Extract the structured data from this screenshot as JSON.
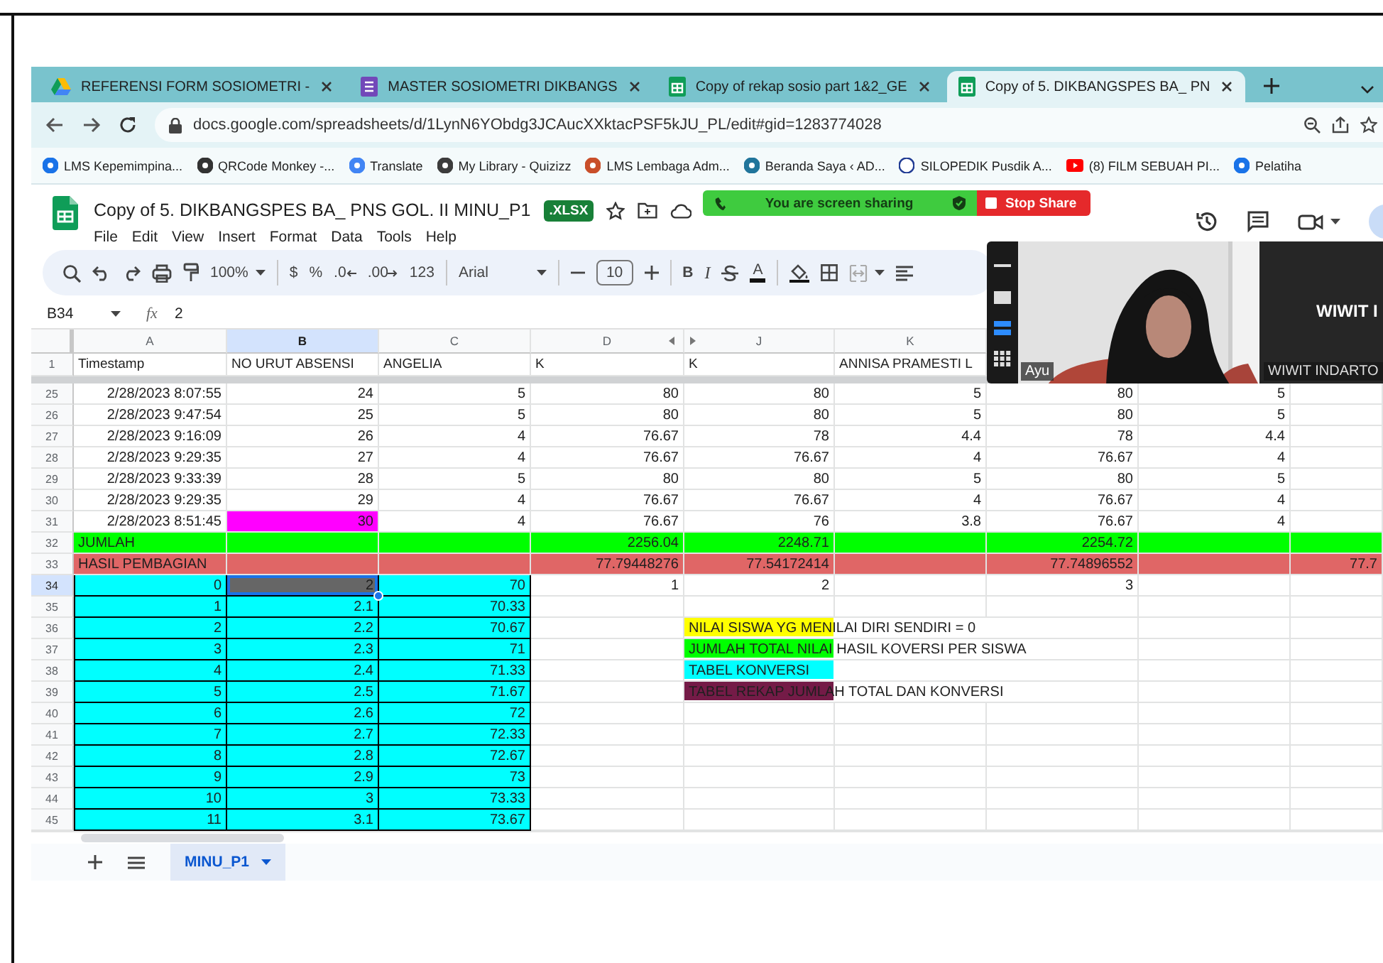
{
  "browser": {
    "tabs": [
      {
        "kind": "drive",
        "title": "REFERENSI FORM SOSIOMETRI -",
        "selected": false
      },
      {
        "kind": "form",
        "title": "MASTER SOSIOMETRI DIKBANGS",
        "selected": false
      },
      {
        "kind": "sheet",
        "title": "Copy of rekap sosio part 1&2_GE",
        "selected": false
      },
      {
        "kind": "sheet",
        "title": "Copy of 5. DIKBANGSPES BA_ PN",
        "selected": true
      }
    ],
    "url": "docs.google.com/spreadsheets/d/1LynN6YObdg3JCAucXXktacPSF5kJU_PL/edit#gid=1283774028",
    "bookmarks": [
      "LMS Kepemimpina...",
      "QRCode Monkey -...",
      "Translate",
      "My Library - Quizizz",
      "LMS Lembaga Adm...",
      "Beranda Saya ‹ AD...",
      "SILOPEDIK Pusdik A...",
      "(8) FILM SEBUAH PI...",
      "Pelatiha"
    ]
  },
  "sheets": {
    "title": "Copy of 5. DIKBANGSPES BA_ PNS GOL. II MINU_P1",
    "badge": ".XLSX",
    "menu": [
      "File",
      "Edit",
      "View",
      "Insert",
      "Format",
      "Data",
      "Tools",
      "Help"
    ],
    "toolbar": {
      "zoom": "100%",
      "currency": "$",
      "percent": "%",
      "decrease_decimals": ".0",
      "increase_decimals": ".00",
      "number_format": "123",
      "font": "Arial",
      "font_size": "10",
      "bold": "B",
      "italic": "I",
      "text_color": "A"
    },
    "formula": {
      "cell": "B34",
      "label": "fx",
      "value": "2"
    }
  },
  "grid": {
    "columns": [
      {
        "letter": "A",
        "selected": false
      },
      {
        "letter": "B",
        "selected": true
      },
      {
        "letter": "C",
        "selected": false
      },
      {
        "letter": "D",
        "selected": false
      },
      {
        "letter": "J",
        "selected": false
      },
      {
        "letter": "K",
        "selected": false
      }
    ],
    "rows": [
      {
        "number": "1",
        "kind": "header",
        "cells": [
          "Timestamp",
          "NO URUT ABSENSI",
          "ANGELIA",
          "K",
          "K",
          "ANNISA PRAMESTI L"
        ]
      },
      {
        "number": "25",
        "kind": "data",
        "cells": [
          "2/28/2023 8:07:55",
          "24",
          "5",
          "80",
          "80",
          "5",
          "80",
          "5"
        ]
      },
      {
        "number": "26",
        "kind": "data",
        "cells": [
          "2/28/2023 9:47:54",
          "25",
          "5",
          "80",
          "80",
          "5",
          "80",
          "5"
        ]
      },
      {
        "number": "27",
        "kind": "data",
        "cells": [
          "2/28/2023 9:16:09",
          "26",
          "4",
          "76.67",
          "78",
          "4.4",
          "78",
          "4.4"
        ]
      },
      {
        "number": "28",
        "kind": "data",
        "cells": [
          "2/28/2023 9:29:35",
          "27",
          "4",
          "76.67",
          "76.67",
          "4",
          "76.67",
          "4"
        ]
      },
      {
        "number": "29",
        "kind": "data",
        "cells": [
          "2/28/2023 9:33:39",
          "28",
          "5",
          "80",
          "80",
          "5",
          "80",
          "5"
        ]
      },
      {
        "number": "30",
        "kind": "data",
        "cells": [
          "2/28/2023 9:29:35",
          "29",
          "4",
          "76.67",
          "76.67",
          "4",
          "76.67",
          "4"
        ]
      },
      {
        "number": "31",
        "kind": "data",
        "cells": [
          "2/28/2023 8:51:45",
          {
            "text": "30",
            "color": "#ff00ff"
          },
          "4",
          "76.67",
          "76",
          "3.8",
          "76.67",
          "4"
        ]
      },
      {
        "number": "32",
        "kind": "summary",
        "color": "#00ff00",
        "cells": [
          {
            "text": "JUMLAH",
            "kind": "label"
          },
          null,
          null,
          "2256.04",
          "2248.71",
          null,
          "2254.72"
        ]
      },
      {
        "number": "33",
        "kind": "summary",
        "color": "#e06666",
        "cells": [
          {
            "text": "HASIL PEMBAGIAN",
            "kind": "label"
          },
          null,
          null,
          "77.79448276",
          "77.54172414",
          null,
          "77.74896552",
          null,
          "77.7"
        ]
      },
      {
        "number": "34",
        "kind": "conversion",
        "cells": [
          {
            "text": "0",
            "color": "#00ffff"
          },
          {
            "text": "2",
            "color": "#666666",
            "selected": true
          },
          {
            "text": "70",
            "color": "#00ffff"
          },
          "1",
          "2",
          null,
          "3"
        ]
      },
      {
        "number": "35",
        "kind": "conversion",
        "cells": [
          {
            "text": "1",
            "color": "#00ffff"
          },
          {
            "text": "2.1",
            "color": "#00ffff"
          },
          {
            "text": "70.33",
            "color": "#00ffff"
          }
        ]
      },
      {
        "number": "36",
        "kind": "conversion",
        "cells": [
          {
            "text": "2",
            "color": "#00ffff"
          },
          {
            "text": "2.2",
            "color": "#00ffff"
          },
          {
            "text": "70.67",
            "color": "#00ffff"
          },
          null,
          {
            "text": "NILAI SISWA YG MENILAI DIRI SENDIRI = 0",
            "color": "#ffff00",
            "kind": "label"
          }
        ]
      },
      {
        "number": "37",
        "kind": "conversion",
        "cells": [
          {
            "text": "3",
            "color": "#00ffff"
          },
          {
            "text": "2.3",
            "color": "#00ffff"
          },
          {
            "text": "71",
            "color": "#00ffff"
          },
          null,
          {
            "text": "JUMLAH TOTAL NILAI HASIL KOVERSI PER SISWA",
            "color": "#00ff00",
            "kind": "label"
          }
        ]
      },
      {
        "number": "38",
        "kind": "conversion",
        "cells": [
          {
            "text": "4",
            "color": "#00ffff"
          },
          {
            "text": "2.4",
            "color": "#00ffff"
          },
          {
            "text": "71.33",
            "color": "#00ffff"
          },
          null,
          {
            "text": "TABEL KONVERSI",
            "color": "#00ffff",
            "kind": "label"
          }
        ]
      },
      {
        "number": "39",
        "kind": "conversion",
        "cells": [
          {
            "text": "5",
            "color": "#00ffff"
          },
          {
            "text": "2.5",
            "color": "#00ffff"
          },
          {
            "text": "71.67",
            "color": "#00ffff"
          },
          null,
          {
            "text": "TABEL REKAP JUMLAH TOTAL DAN KONVERSI",
            "color": "#741b47",
            "kind": "label"
          }
        ]
      },
      {
        "number": "40",
        "kind": "conversion",
        "cells": [
          {
            "text": "6",
            "color": "#00ffff"
          },
          {
            "text": "2.6",
            "color": "#00ffff"
          },
          {
            "text": "72",
            "color": "#00ffff"
          }
        ]
      },
      {
        "number": "41",
        "kind": "conversion",
        "cells": [
          {
            "text": "7",
            "color": "#00ffff"
          },
          {
            "text": "2.7",
            "color": "#00ffff"
          },
          {
            "text": "72.33",
            "color": "#00ffff"
          }
        ]
      },
      {
        "number": "42",
        "kind": "conversion",
        "cells": [
          {
            "text": "8",
            "color": "#00ffff"
          },
          {
            "text": "2.8",
            "color": "#00ffff"
          },
          {
            "text": "72.67",
            "color": "#00ffff"
          }
        ]
      },
      {
        "number": "43",
        "kind": "conversion",
        "cells": [
          {
            "text": "9",
            "color": "#00ffff"
          },
          {
            "text": "2.9",
            "color": "#00ffff"
          },
          {
            "text": "73",
            "color": "#00ffff"
          }
        ]
      },
      {
        "number": "44",
        "kind": "conversion",
        "cells": [
          {
            "text": "10",
            "color": "#00ffff"
          },
          {
            "text": "3",
            "color": "#00ffff"
          },
          {
            "text": "73.33",
            "color": "#00ffff"
          }
        ]
      },
      {
        "number": "45",
        "kind": "conversion",
        "cells": [
          {
            "text": "11",
            "color": "#00ffff"
          },
          {
            "text": "3.1",
            "color": "#00ffff"
          },
          {
            "text": "73.67",
            "color": "#00ffff"
          }
        ]
      }
    ]
  },
  "sheet_tabs": [
    {
      "name": "MINU_P1",
      "selected": true
    }
  ],
  "share_bar": {
    "status": "You are screen sharing",
    "stop": "Stop Share"
  },
  "call": {
    "views": [
      {
        "selected": false
      },
      {
        "selected": false
      },
      {
        "selected": true
      },
      {
        "selected": false
      }
    ],
    "participants": [
      {
        "kind": "video",
        "name": "Ayu"
      },
      {
        "kind": "avatar",
        "display": "WIWIT I",
        "name": "WIWIT INDARTO"
      }
    ]
  }
}
